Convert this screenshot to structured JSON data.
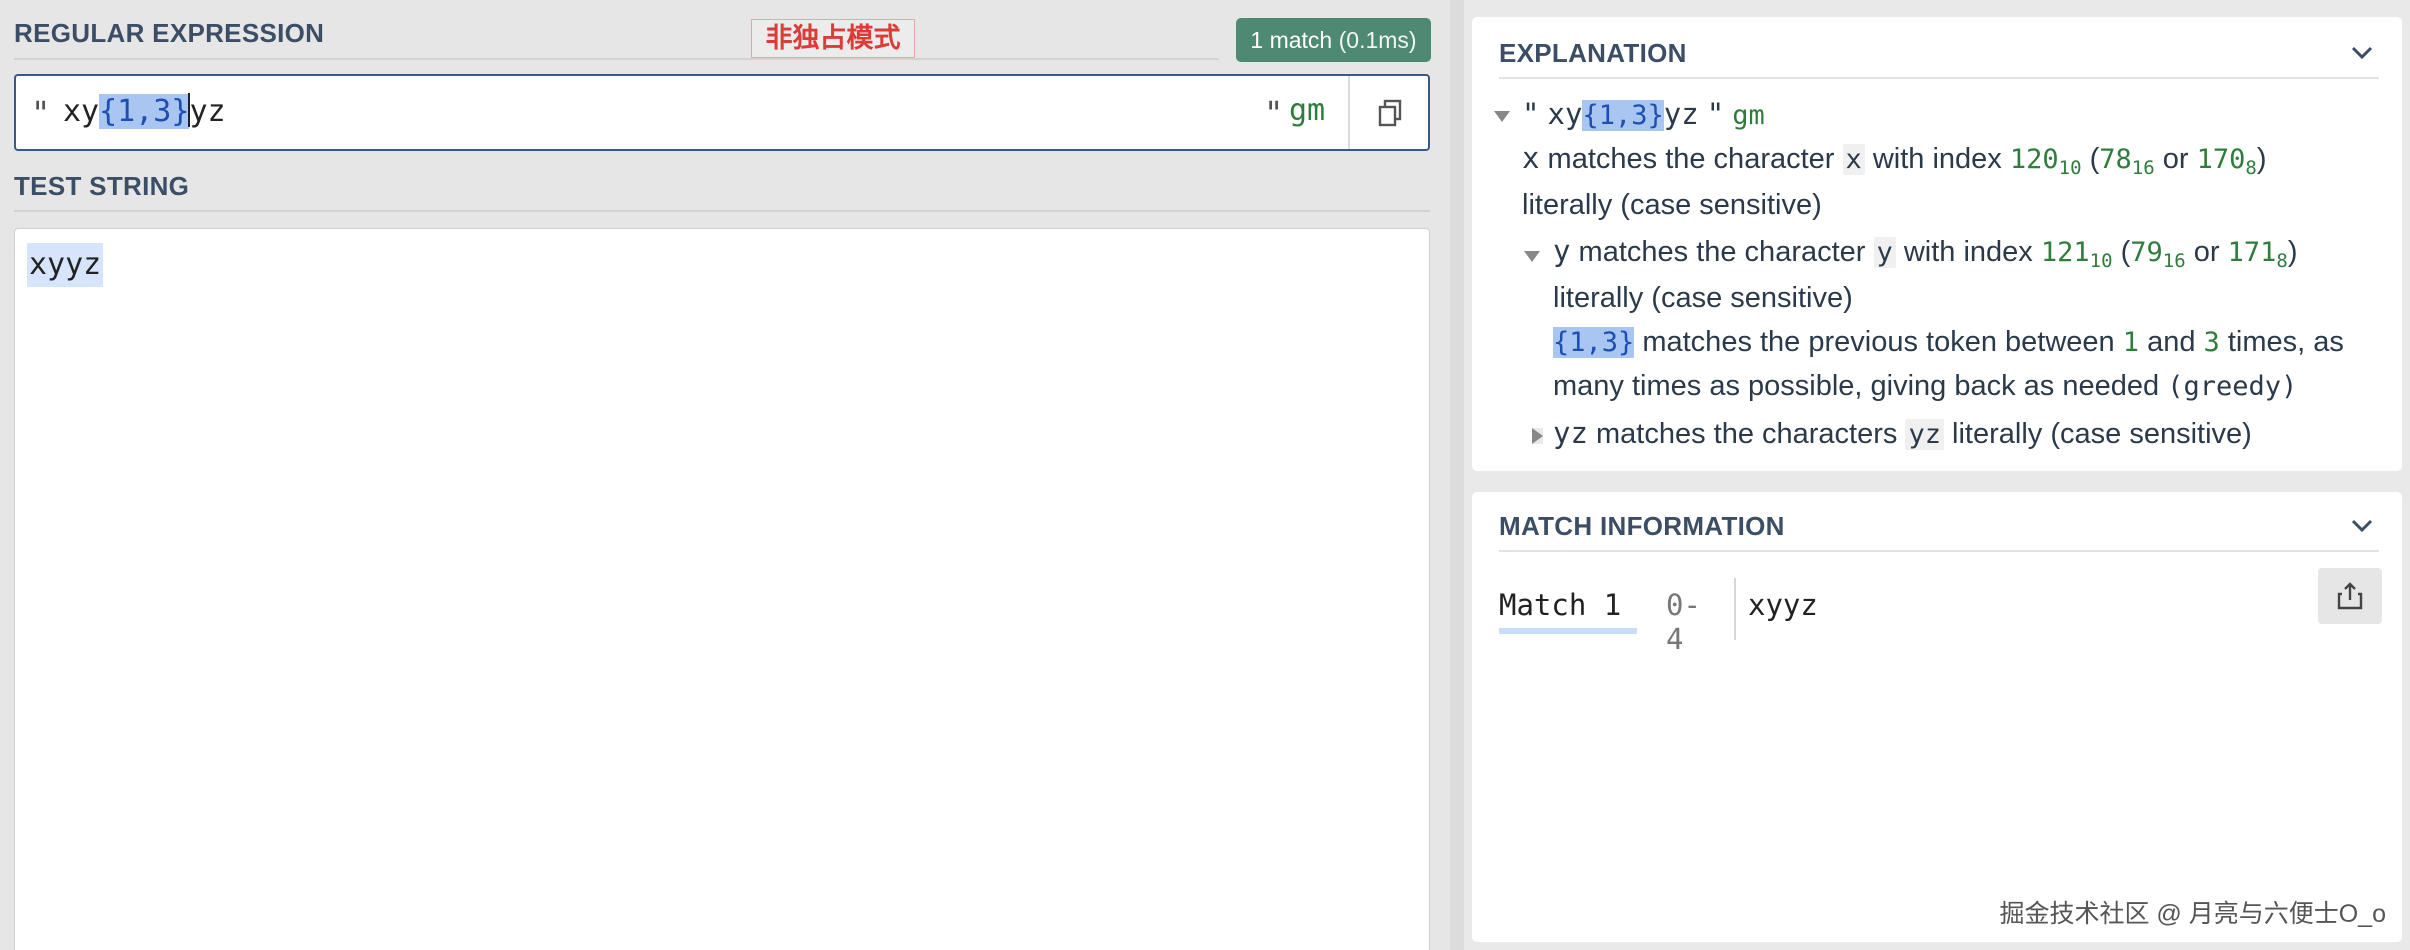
{
  "regex_section": {
    "title": "REGULAR EXPRESSION",
    "annotation": "非独占模式",
    "match_badge": {
      "count": "1 match",
      "time": "(0.1ms)"
    },
    "open_quote": "\"",
    "pattern_before": "xy",
    "pattern_quantifier": "{1,3}",
    "pattern_after": "yz",
    "close_quote": "\"",
    "flags": "gm"
  },
  "test_section": {
    "title": "TEST STRING",
    "text": "xyyz"
  },
  "explanation": {
    "title": "EXPLANATION",
    "root": {
      "quote_open": "\"",
      "before": "xy",
      "quant": "{1,3}",
      "after": "yz",
      "quote_close": "\"",
      "flags": "gm"
    },
    "x_line": {
      "token": "x",
      "text1": "matches the character",
      "char": "x",
      "text2": "with index",
      "dec": "120",
      "dec_base": "10",
      "hex": "78",
      "hex_base": "16",
      "or": "or",
      "oct": "170",
      "oct_base": "8",
      "cont": "literally (case sensitive)"
    },
    "y_line": {
      "token": "y",
      "text1": "matches the character",
      "char": "y",
      "text2": "with index",
      "dec": "121",
      "dec_base": "10",
      "hex": "79",
      "hex_base": "16",
      "or": "or",
      "oct": "171",
      "oct_base": "8",
      "cont": "literally (case sensitive)"
    },
    "quant_line": {
      "token": "{1,3}",
      "text1": "matches the previous token between",
      "min": "1",
      "and": "and",
      "max": "3",
      "text2": "times, as",
      "cont1": "many times as possible, giving back as needed",
      "greedy": "(greedy)"
    },
    "yz_line": {
      "token": "yz",
      "text1": "matches the characters",
      "chars": "yz",
      "text2": "literally (case sensitive)"
    }
  },
  "match_info": {
    "title": "MATCH INFORMATION",
    "match_label": "Match 1",
    "range": "0-4",
    "value": "xyyz"
  },
  "watermark": "掘金技术社区 @ 月亮与六便士O_o",
  "colors": {
    "accent": "#3a5a85",
    "badge": "#4e8a73",
    "quantifier_highlight": "#a9c6f3",
    "annotation_red": "#dd3b37",
    "flags_green": "#2f7d3c"
  },
  "icons": [
    "copy-icon",
    "chevron-down-icon",
    "triangle-down-icon",
    "triangle-right-icon",
    "share-icon"
  ]
}
